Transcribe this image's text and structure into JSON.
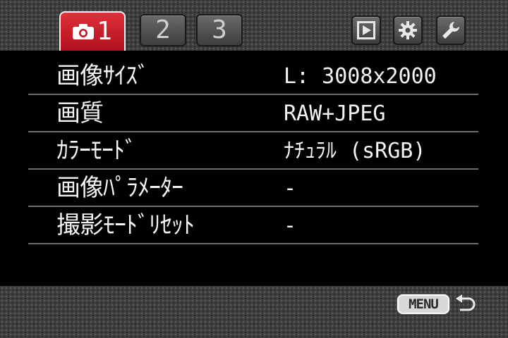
{
  "tabs": [
    {
      "label": "1",
      "icon": "camera-icon",
      "active": true
    },
    {
      "label": "2",
      "active": false
    },
    {
      "label": "3",
      "active": false
    }
  ],
  "right_icons": [
    "playback-icon",
    "settings-gear-icon",
    "wrench-icon"
  ],
  "menu_rows": [
    {
      "label": "画像ｻｲｽﾞ",
      "value": "L: 3008x2000"
    },
    {
      "label": "画質",
      "value": "RAW+JPEG"
    },
    {
      "label": "ｶﾗｰﾓｰﾄﾞ",
      "value": "ﾅﾁｭﾗﾙ (sRGB)"
    },
    {
      "label": "画像ﾊﾟﾗﾒｰﾀｰ",
      "value": "-"
    },
    {
      "label": "撮影ﾓｰﾄﾞﾘｾｯﾄ",
      "value": "-"
    }
  ],
  "footer": {
    "menu_label": "MENU",
    "back_icon": "return-arrow-icon"
  },
  "colors": {
    "active_tab": "#c81424",
    "bar_bg": "#3e3e3e",
    "divider": "#6e6e6e"
  }
}
